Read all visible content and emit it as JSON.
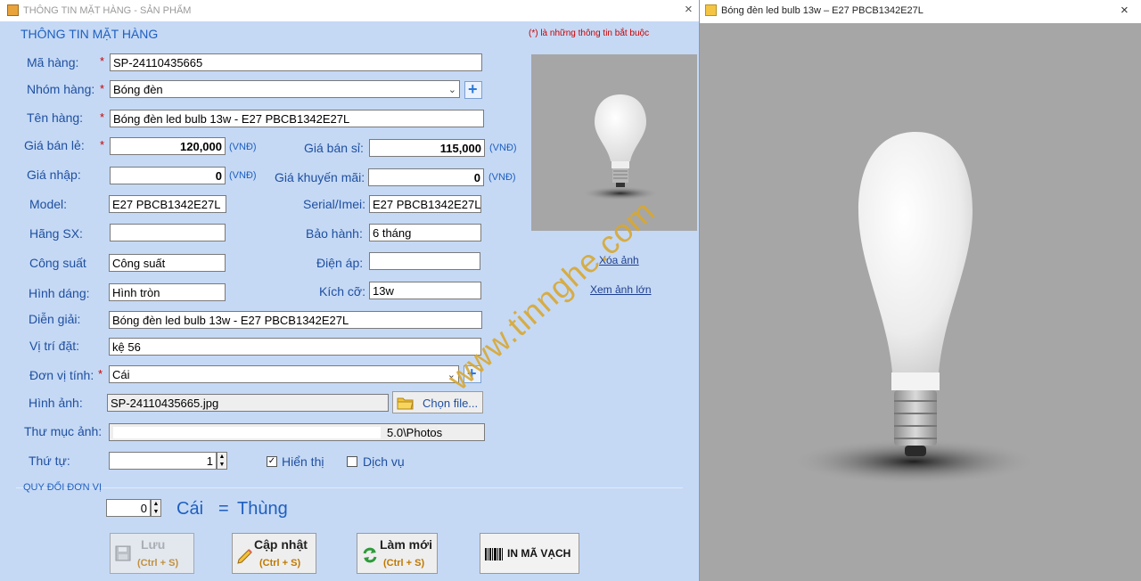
{
  "left_window": {
    "title": "THÔNG TIN MẶT HÀNG - SẢN PHẨM",
    "section_title": "THÔNG TIN MẶT HÀNG",
    "required_note": "(*) là những thông tin bắt buộc",
    "fields": {
      "ma_hang": {
        "label": "Mã hàng:",
        "value": "SP-24110435665"
      },
      "nhom_hang": {
        "label": "Nhóm hàng:",
        "value": "Bóng đèn"
      },
      "ten_hang": {
        "label": "Tên hàng:",
        "value": "Bóng đèn led bulb 13w - E27 PBCB1342E27L"
      },
      "gia_ban_le": {
        "label": "Giá bán lẻ:",
        "value": "120,000",
        "unit": "(VNĐ)"
      },
      "gia_ban_si": {
        "label": "Giá bán sỉ:",
        "value": "115,000",
        "unit": "(VNĐ)"
      },
      "gia_nhap": {
        "label": "Giá nhập:",
        "value": "0",
        "unit": "(VNĐ)"
      },
      "gia_khuyen_mai": {
        "label": "Giá khuyến mãi:",
        "value": "0",
        "unit": "(VNĐ)"
      },
      "model": {
        "label": "Model:",
        "value": "E27 PBCB1342E27L"
      },
      "serial": {
        "label": "Serial/Imei:",
        "value": "E27 PBCB1342E27L"
      },
      "hang_sx": {
        "label": "Hãng SX:",
        "value": ""
      },
      "bao_hanh": {
        "label": "Bảo hành:",
        "value": "6 tháng"
      },
      "cong_suat": {
        "label": "Công suất",
        "value": "Công suất"
      },
      "dien_ap": {
        "label": "Điện áp:",
        "value": ""
      },
      "hinh_dang": {
        "label": "Hình dáng:",
        "value": "Hình tròn"
      },
      "kich_co": {
        "label": "Kích cỡ:",
        "value": "13w"
      },
      "dien_giai": {
        "label": "Diễn giải:",
        "value": "Bóng đèn led bulb 13w - E27 PBCB1342E27L"
      },
      "vi_tri_dat": {
        "label": "Vị trí đặt:",
        "value": "kệ 56"
      },
      "don_vi_tinh": {
        "label": "Đơn vị tính:",
        "value": "Cái"
      },
      "hinh_anh": {
        "label": "Hình ảnh:",
        "value": "SP-24110435665.jpg"
      },
      "thu_muc_anh": {
        "label": "Thư mục ảnh:",
        "value": "5.0\\Photos"
      },
      "thu_tu": {
        "label": "Thứ tự:",
        "value": "1"
      }
    },
    "required_star": "*",
    "choose_file": "Chọn file...",
    "checkbox_hien_thi": {
      "label": "Hiển thị",
      "checked": true
    },
    "checkbox_dich_vu": {
      "label": "Dịch vụ",
      "checked": false
    },
    "links": {
      "delete_image": "Xóa ảnh",
      "view_large": "Xem ảnh lớn"
    },
    "conversion": {
      "title": "QUY ĐỔI ĐƠN VỊ",
      "value": "0",
      "unit_from": "Cái",
      "equals": "=",
      "unit_to": "Thùng"
    },
    "buttons": {
      "save": {
        "label": "Lưu",
        "shortcut": "(Ctrl + S)"
      },
      "update": {
        "label": "Cập nhật",
        "shortcut": "(Ctrl + S)"
      },
      "refresh": {
        "label": "Làm mới",
        "shortcut": "(Ctrl + S)"
      },
      "barcode": {
        "label": "IN MÃ VẠCH"
      }
    },
    "close_glyph": "×"
  },
  "right_window": {
    "title": "Bóng đèn led bulb 13w – E27 PBCB1342E27L",
    "close_glyph": "×"
  },
  "watermark": "www.tinnghe.com",
  "colors": {
    "form_bg": "#c5d9f5",
    "label_blue": "#1f4f9f",
    "required_red": "#cc0000",
    "image_bg": "#a6a6a6",
    "watermark": "#d8a832"
  }
}
